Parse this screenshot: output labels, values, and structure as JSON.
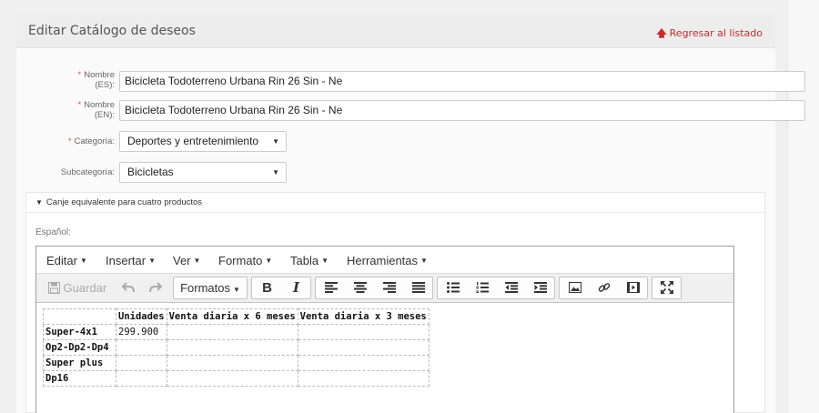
{
  "header": {
    "title": "Editar Catálogo de deseos",
    "back_link": "Regresar al listado"
  },
  "form": {
    "nombre_es": {
      "label": "Nombre (ES):",
      "value": "Bicicleta Todoterreno Urbana Rin 26 Sin - Ne"
    },
    "nombre_en": {
      "label": "Nombre (EN):",
      "value": "Bicicleta Todoterreno Urbana Rin 26 Sin - Ne"
    },
    "categoria": {
      "label": "Categoría:",
      "value": "Deportes y entretenimiento"
    },
    "subcategoria": {
      "label": "Subcategoría:",
      "value": "Bicicletas"
    }
  },
  "section": {
    "title": "Canje equivalente para cuatro productos",
    "lang_label": "Español:"
  },
  "editor": {
    "menu": [
      "Editar",
      "Insertar",
      "Ver",
      "Formato",
      "Tabla",
      "Herramientas"
    ],
    "toolbar": {
      "save": "Guardar",
      "formats": "Formatos",
      "bold": "B",
      "italic": "I"
    },
    "table": {
      "headers": [
        "",
        "Unidades",
        "Venta diaria x 6 meses",
        "Venta diaria x 3 meses"
      ],
      "rows": [
        [
          "Super-4x1",
          "299.900",
          "",
          ""
        ],
        [
          "Op2-Dp2-Dp4",
          "",
          "",
          ""
        ],
        [
          "Super plus",
          "",
          "",
          ""
        ],
        [
          "Dp16",
          "",
          "",
          ""
        ]
      ]
    }
  },
  "colors": {
    "accent": "#c12e2a",
    "required": "#d9534f"
  }
}
